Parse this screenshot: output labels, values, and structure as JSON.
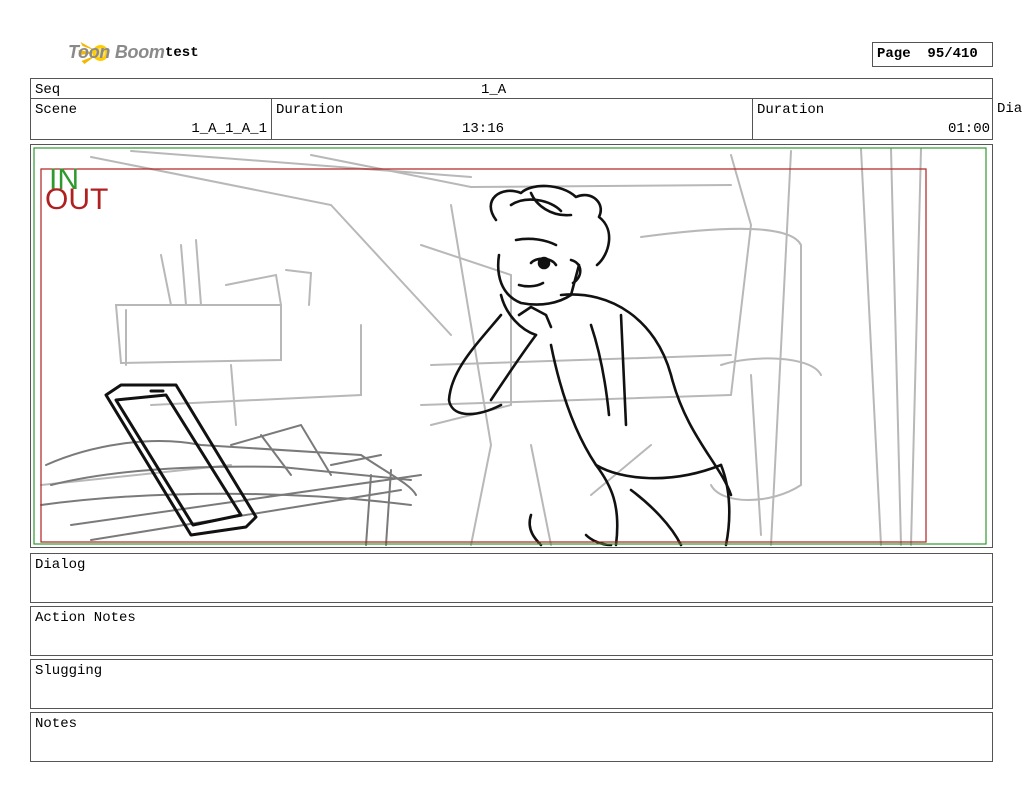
{
  "header": {
    "brand": "Toon Boom",
    "project_title": "test",
    "page_label": "Page",
    "page_value": "95/410"
  },
  "info": {
    "seq_label": "Seq",
    "seq_value": "1_A",
    "scene_label": "Scene",
    "scene_value": "1_A_1_A_1",
    "duration1_label": "Duration",
    "duration1_value": "13:16",
    "duration2_label": "Duration",
    "duration2_value": "01:00",
    "cutoff_label": "Dia"
  },
  "panel": {
    "in_marker": "IN",
    "out_marker": "OUT",
    "in_color": "#2e9a2e",
    "out_color": "#b02020"
  },
  "sections": {
    "dialog": "Dialog",
    "action_notes": "Action Notes",
    "slugging": "Slugging",
    "notes": "Notes"
  }
}
